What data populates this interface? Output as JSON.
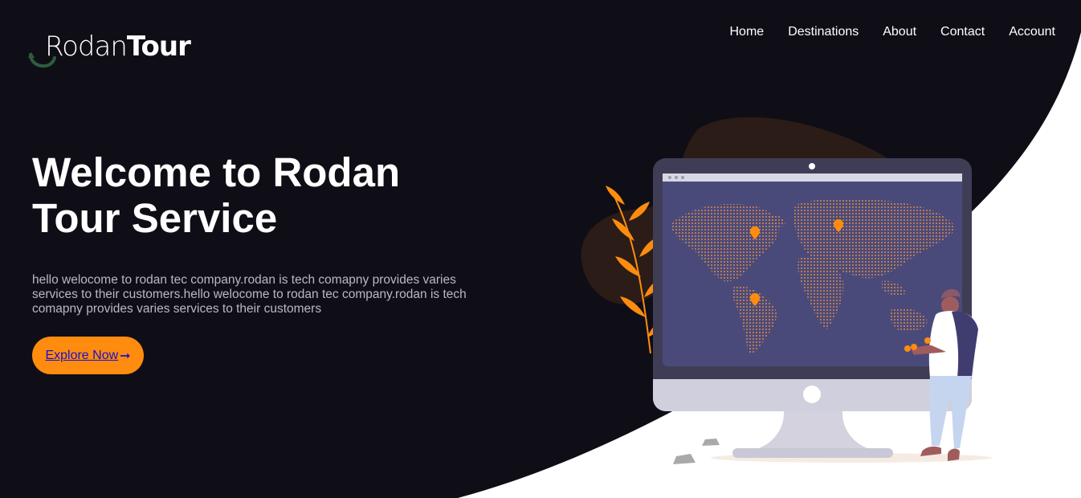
{
  "brand": {
    "name_light": "Rodan",
    "name_bold": "Tour"
  },
  "nav": {
    "items": [
      {
        "label": "Home"
      },
      {
        "label": "Destinations"
      },
      {
        "label": "About"
      },
      {
        "label": "Contact"
      },
      {
        "label": "Account"
      }
    ]
  },
  "hero": {
    "title_line1": "Welcome to Rodan",
    "title_line2": "Tour Service",
    "description": "hello welocome to rodan tec company.rodan is tech comapny provides varies services to their customers.hello welocome to rodan tec company.rodan is tech comapny provides varies services to their customers",
    "cta_label": "Explore Now",
    "cta_icon": "arrow-right-icon"
  },
  "colors": {
    "background_dark": "#0f0e17",
    "accent": "#ff8c0e",
    "text_light": "#ffffff",
    "text_muted": "#b8b8c8"
  }
}
